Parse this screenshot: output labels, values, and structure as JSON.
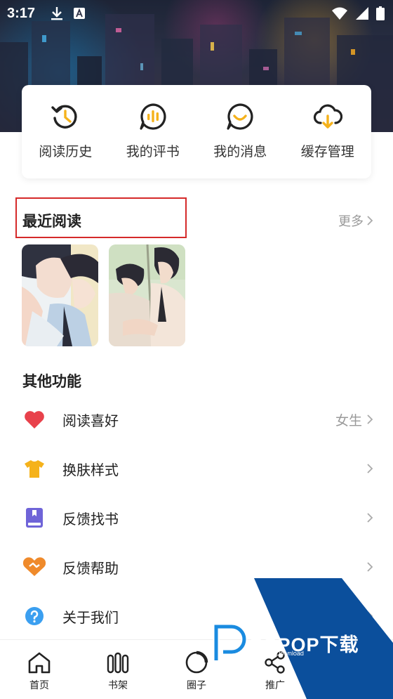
{
  "status_bar": {
    "time": "3:17"
  },
  "quick_actions": [
    {
      "label": "阅读历史",
      "icon": "history-icon"
    },
    {
      "label": "我的评书",
      "icon": "review-icon"
    },
    {
      "label": "我的消息",
      "icon": "message-icon"
    },
    {
      "label": "缓存管理",
      "icon": "cloud-download-icon"
    }
  ],
  "recent": {
    "title": "最近阅读",
    "more": "更多",
    "covers": [
      "comic-cover-1",
      "comic-cover-2"
    ]
  },
  "other": {
    "title": "其他功能",
    "items": [
      {
        "label": "阅读喜好",
        "value": "女生",
        "icon": "heart-icon",
        "color": "#e8414b"
      },
      {
        "label": "换肤样式",
        "value": "",
        "icon": "tshirt-icon",
        "color": "#f5b21b"
      },
      {
        "label": "反馈找书",
        "value": "",
        "icon": "book-icon",
        "color": "#6f64d8"
      },
      {
        "label": "反馈帮助",
        "value": "",
        "icon": "handshake-icon",
        "color": "#ef8a2b"
      },
      {
        "label": "关于我们",
        "value": "",
        "icon": "question-icon",
        "color": "#3b9ff0"
      }
    ]
  },
  "bottom_nav": [
    {
      "label": "首页",
      "icon": "home-icon"
    },
    {
      "label": "书架",
      "icon": "bookshelf-icon"
    },
    {
      "label": "圈子",
      "icon": "circle-icon"
    },
    {
      "label": "推广",
      "icon": "share-icon"
    }
  ],
  "watermark": {
    "text": "PCPOP下载",
    "sub": "PCPOP Download"
  },
  "colors": {
    "accent": "#f5b21b",
    "highlight_box": "#d52a2a",
    "watermark_blue": "#0b4f9c"
  }
}
